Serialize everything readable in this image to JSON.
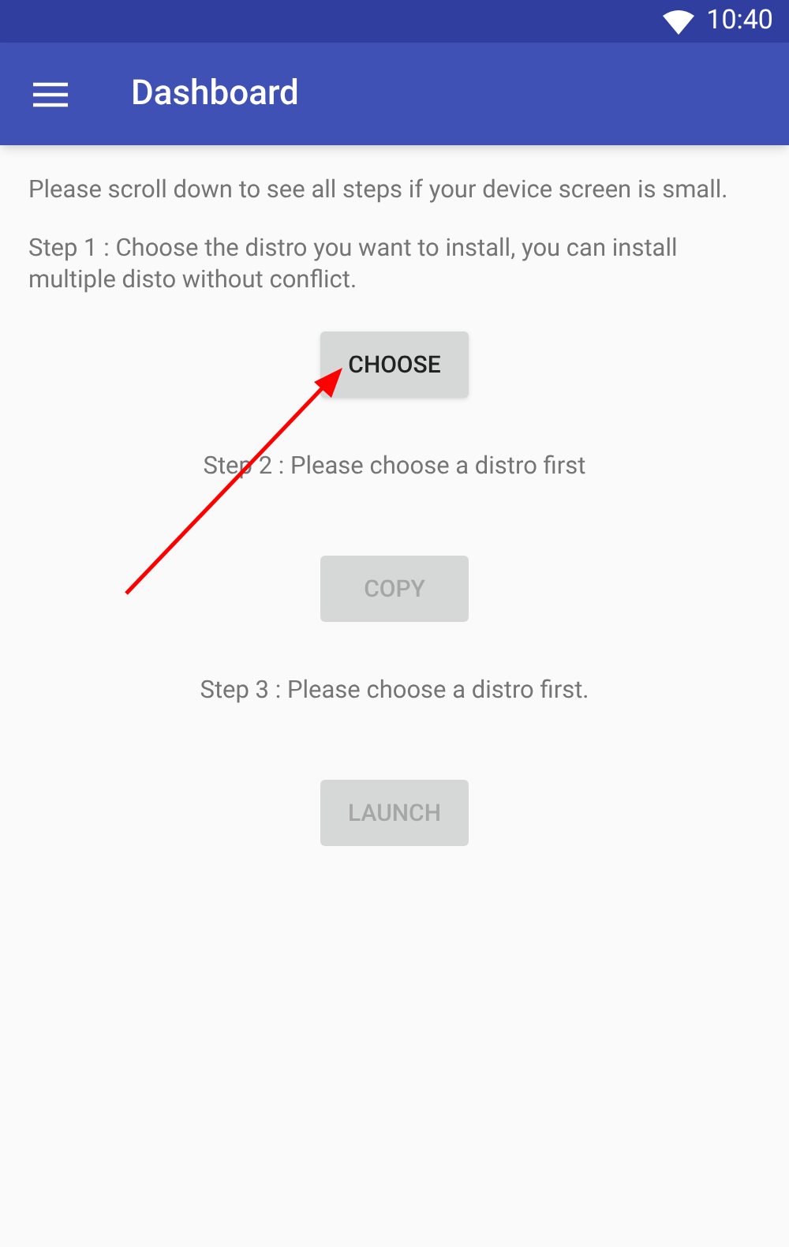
{
  "status_bar": {
    "time": "10:40"
  },
  "app_bar": {
    "title": "Dashboard"
  },
  "intro": "Please scroll down to see all steps if your device screen is small.",
  "steps": [
    {
      "text": "Step 1 : Choose the distro you want to install, you can install multiple disto without conflict.",
      "button": {
        "label": "CHOOSE",
        "disabled": false
      }
    },
    {
      "text": "Step 2 : Please choose a distro first",
      "button": {
        "label": "COPY",
        "disabled": true
      }
    },
    {
      "text": "Step 3 : Please choose a distro first.",
      "button": {
        "label": "LAUNCH",
        "disabled": true
      }
    }
  ],
  "annotations": [
    {
      "kind": "arrow"
    }
  ]
}
